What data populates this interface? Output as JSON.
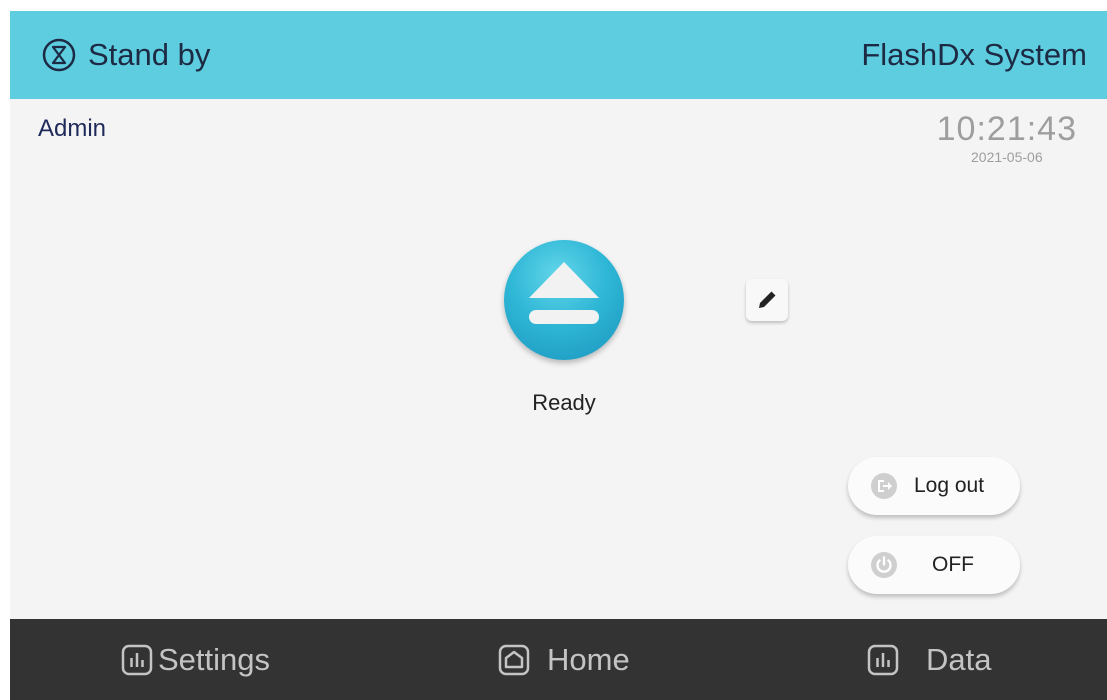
{
  "header": {
    "status": "Stand by",
    "status_icon": "hourglass-icon",
    "system_title": "FlashDx System",
    "color": "#5ecddf"
  },
  "user": {
    "name": "Admin"
  },
  "clock": {
    "time": "10:21:43",
    "date": "2021-05-06"
  },
  "main": {
    "eject_icon": "eject-icon",
    "status_label": "Ready",
    "edit_icon": "pencil-icon",
    "accent_color": "#2fb7d6"
  },
  "actions": {
    "logout_label": "Log out",
    "logout_icon": "logout-icon",
    "off_label": "OFF",
    "off_icon": "power-icon"
  },
  "nav": {
    "items": [
      {
        "label": "Settings",
        "icon": "bar-chart-icon"
      },
      {
        "label": "Home",
        "icon": "home-icon"
      },
      {
        "label": "Data",
        "icon": "bar-chart-icon"
      }
    ],
    "background": "#333333"
  }
}
